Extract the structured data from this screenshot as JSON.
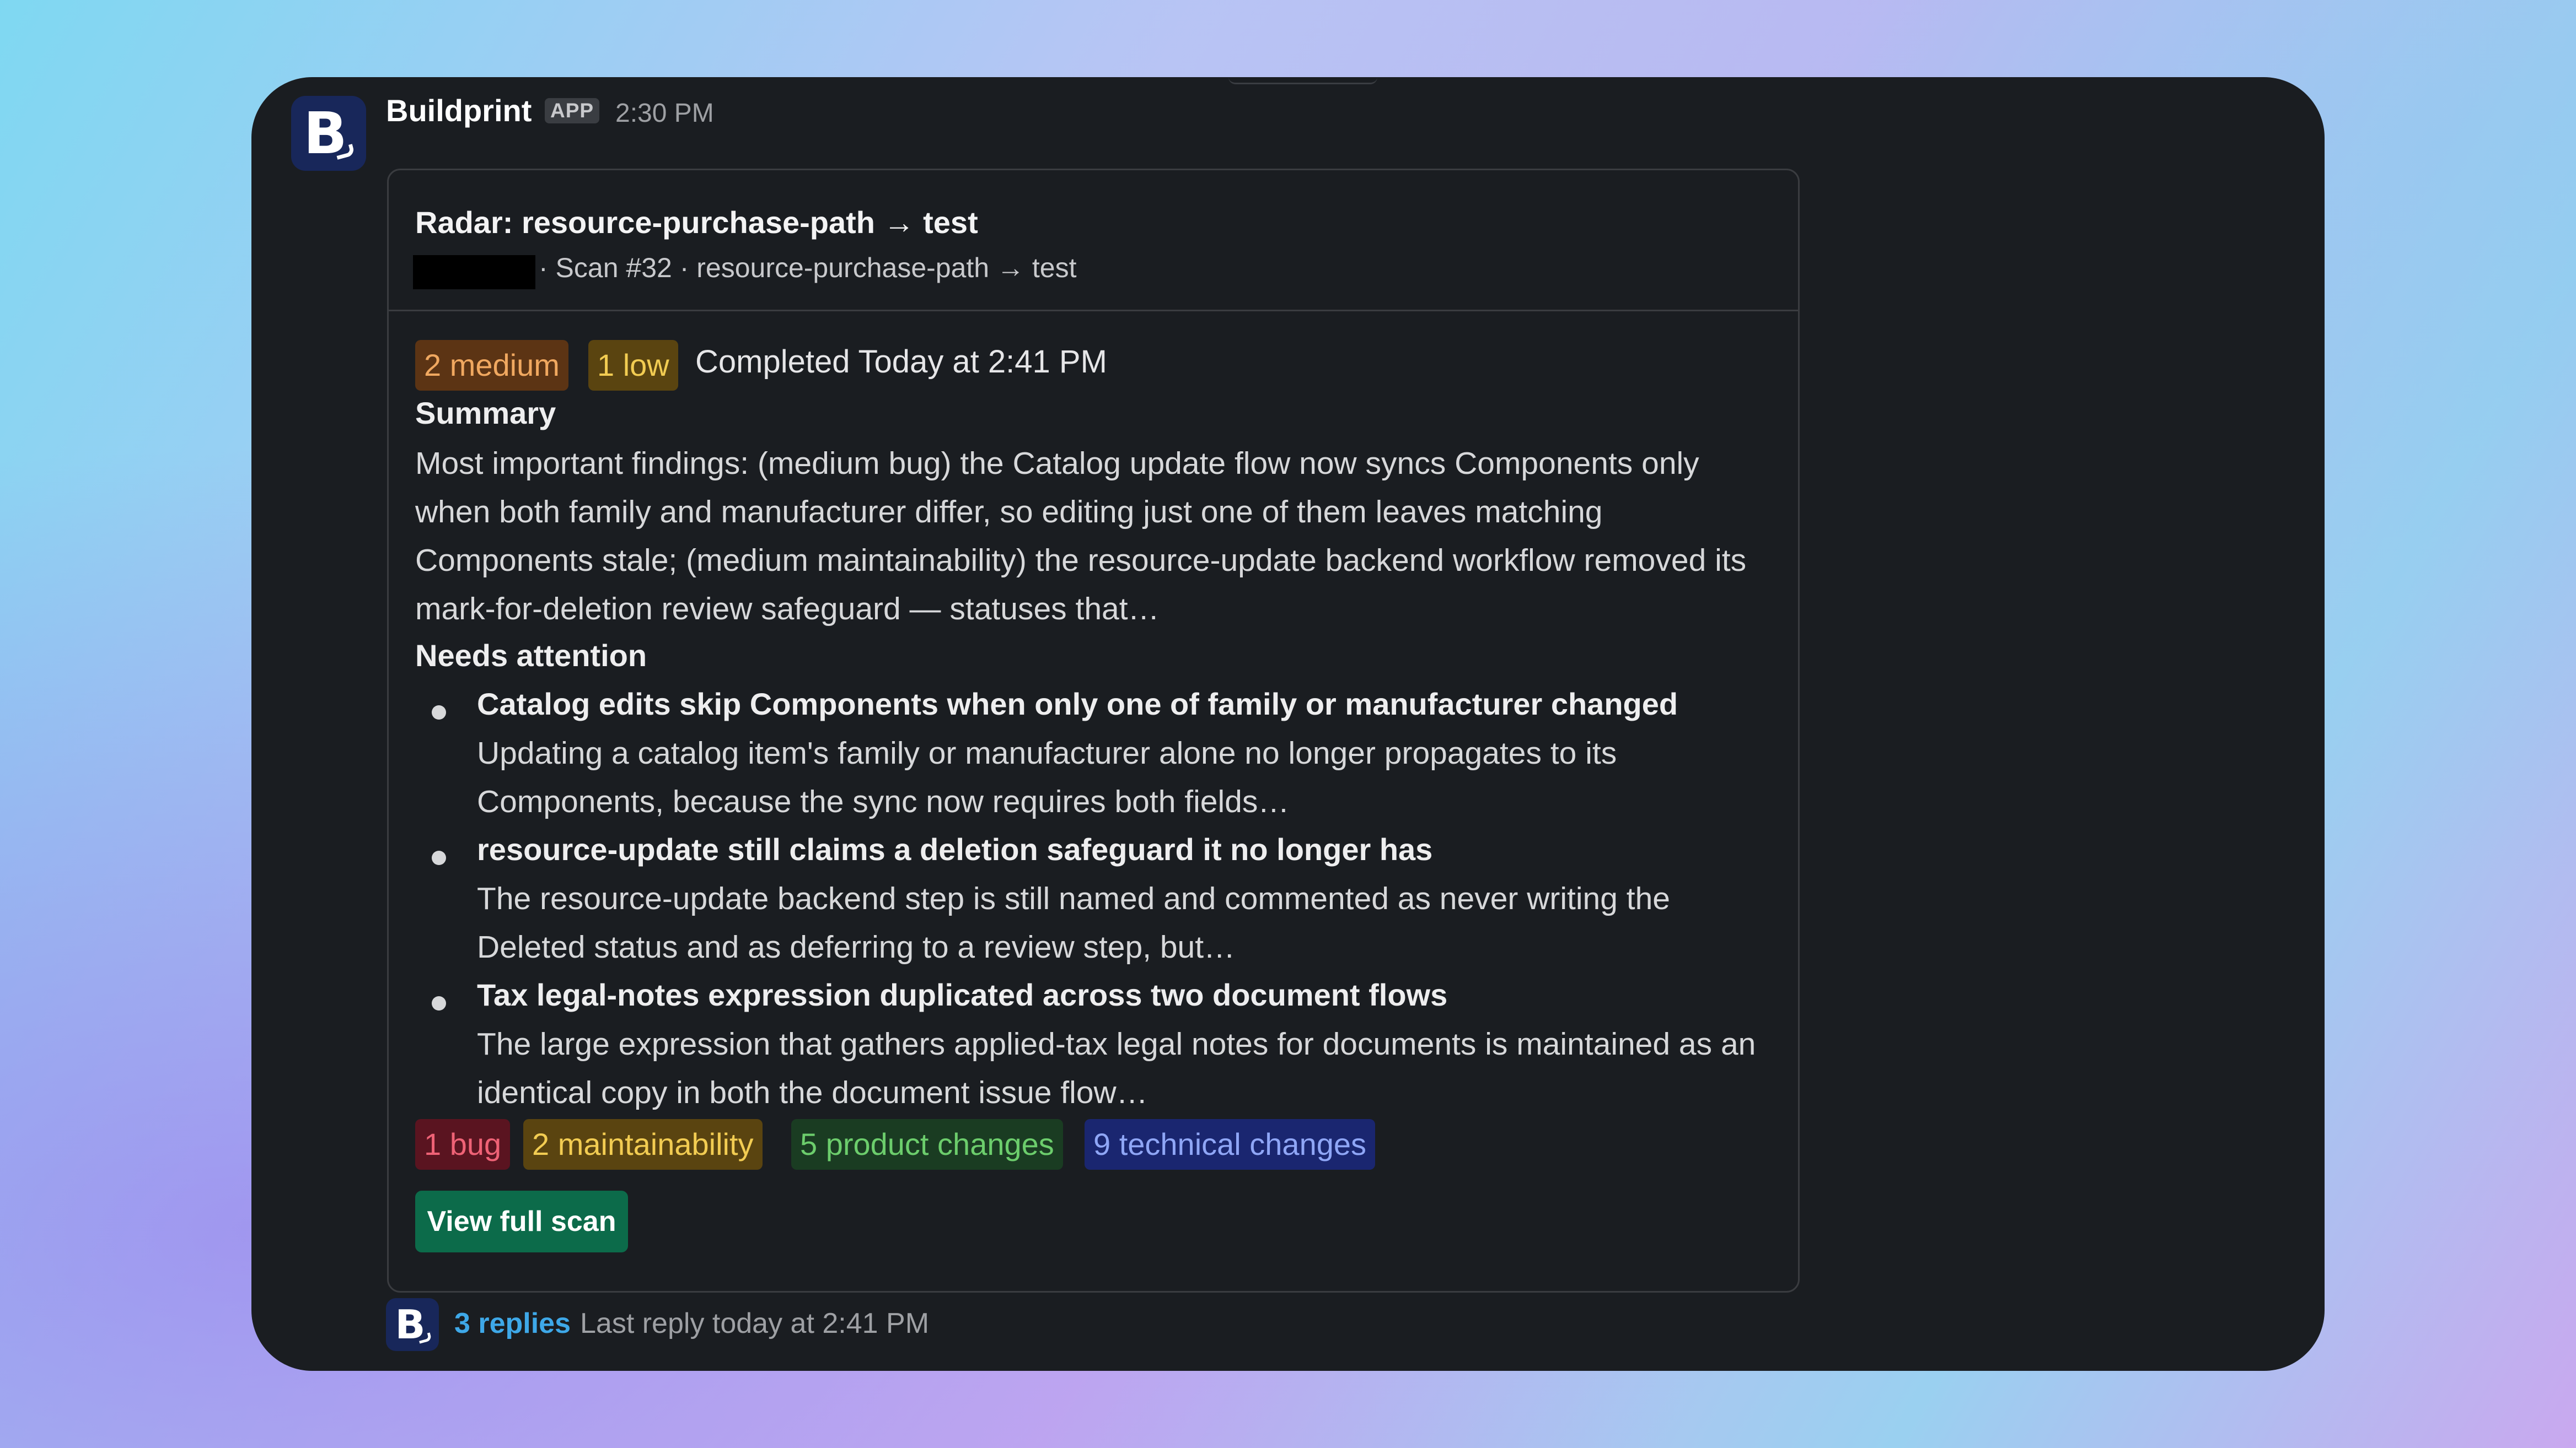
{
  "message": {
    "sender": "Buildprint",
    "app_badge": "APP",
    "time": "2:30 PM",
    "avatar_letter": "B"
  },
  "card": {
    "title": "Radar: resource-purchase-path → test",
    "subtitle": "· Scan #32 · resource-purchase-path → test",
    "severity": {
      "medium": "2 medium",
      "low": "1 low"
    },
    "completed": "Completed Today at 2:41 PM",
    "summary_heading": "Summary",
    "summary_text": "Most important findings: (medium bug) the Catalog update flow now syncs Components only when both family and manufacturer differ, so editing just one of them leaves matching Components stale; (medium maintainability) the resource-update backend workflow removed its mark-for-deletion review safeguard — statuses that…",
    "needs_heading": "Needs attention",
    "findings": [
      {
        "title": "Catalog edits skip Components when only one of family or manufacturer changed",
        "desc": "Updating a catalog item's family or manufacturer alone no longer propagates to its Components, because the sync now requires both fields…"
      },
      {
        "title": "resource-update still claims a deletion safeguard it no longer has",
        "desc": "The resource-update backend step is still named and commented as never writing the Deleted status and as deferring to a review step, but…"
      },
      {
        "title": "Tax legal-notes expression duplicated across two document flows",
        "desc": "The large expression that gathers applied-tax legal notes for documents is maintained as an identical copy in both the document issue flow…"
      }
    ],
    "tags": {
      "bug": "1 bug",
      "maintainability": "2 maintainability",
      "product": "5 product changes",
      "technical": "9 technical changes"
    },
    "button": "View full scan"
  },
  "thread": {
    "replies": "3 replies",
    "last_reply": "Last reply today at 2:41 PM"
  },
  "colors": {
    "window_bg": "#1a1d21",
    "button_bg": "#0c6b4a",
    "link": "#3ea8e8",
    "severity_medium": "#f0a860",
    "severity_low": "#f2cc52",
    "tag_bug": "#ef6276",
    "tag_product": "#6ccd6c",
    "tag_technical": "#8fa6f6"
  }
}
